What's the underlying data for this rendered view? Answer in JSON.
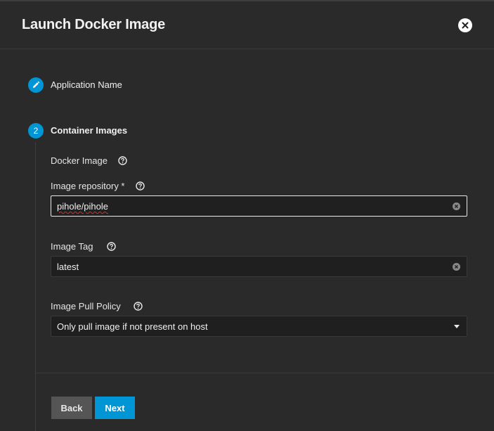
{
  "dialog": {
    "title": "Launch Docker Image"
  },
  "steps": [
    {
      "marker": "pencil-icon",
      "label": "Application Name"
    },
    {
      "marker": "2",
      "label": "Container Images"
    }
  ],
  "docker_image": {
    "section_label": "Docker Image",
    "repository": {
      "label": "Image repository *",
      "value": "pihole/pihole"
    },
    "tag": {
      "label": "Image Tag",
      "value": "latest"
    },
    "pull_policy": {
      "label": "Image Pull Policy",
      "value": "Only pull image if not present on host"
    }
  },
  "actions": {
    "back_label": "Back",
    "next_label": "Next"
  },
  "colors": {
    "accent": "#0095d5",
    "background": "#2a2a2a",
    "input_bg": "#1f1f1f"
  }
}
